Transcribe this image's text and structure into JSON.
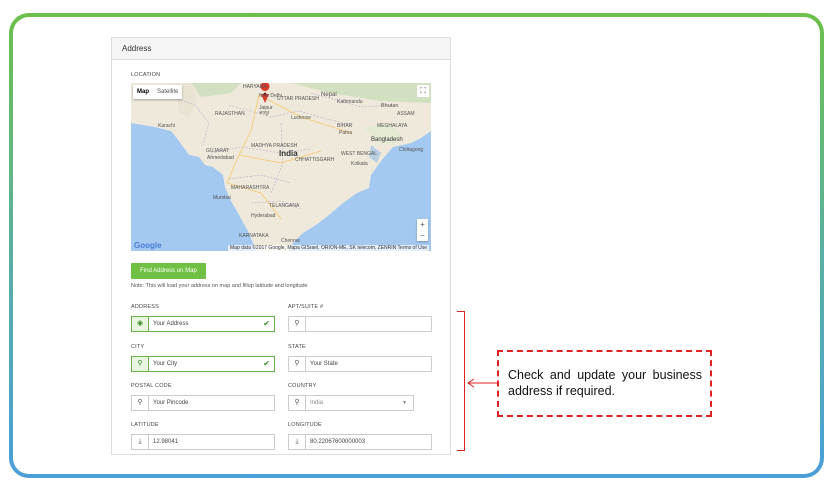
{
  "panel": {
    "title": "Address"
  },
  "location_label": "LOCATION",
  "map": {
    "type_map": "Map",
    "type_satellite": "Satellite",
    "fullscreen_glyph": "⛶",
    "zoom_in": "+",
    "zoom_out": "−",
    "logo": "Google",
    "footer": "Map data ©2017 Google, Mapa GISrael, ORION-ME, SK telecom, ZENRIN   Terms of Use",
    "places": {
      "haryana": "HARYANA",
      "delhi": "New Delhi",
      "jaipur": "Jaipur",
      "jaipur_native": "जयपुर",
      "uttar_pradesh": "UTTAR PRADESH",
      "lucknow": "Lucknow",
      "nepal": "Nepal",
      "kathmandu": "Kathmandu",
      "bhutan": "Bhutan",
      "assam": "ASSAM",
      "meghalaya": "MEGHALAYA",
      "rajasthan": "RAJASTHAN",
      "karachi": "Karachi",
      "bihar": "BIHAR",
      "patna": "Patna",
      "bangladesh": "Bangladesh",
      "gujarat": "GUJARAT",
      "ahmedabad": "Ahmedabad",
      "madhya_pradesh": "MADHYA PRADESH",
      "india": "India",
      "chhattisgarh": "CHHATTISGARH",
      "west_bengal": "WEST BENGAL",
      "kolkata": "Kolkata",
      "chittagong": "Chittagong",
      "maharashtra": "MAHARASHTRA",
      "mumbai": "Mumbai",
      "telangana": "TELANGANA",
      "hyderabad": "Hyderabad",
      "karnataka": "KARNATAKA",
      "chennai": "Chennai"
    }
  },
  "find_button": "Find Address on Map",
  "note": "Note: This will load your address on map and fillup latitude and longitude",
  "fields": {
    "address": {
      "label": "ADDRESS",
      "value": "Your Address"
    },
    "apt": {
      "label": "APT/SUITE #",
      "value": ""
    },
    "city": {
      "label": "CITY",
      "value": "Your City"
    },
    "state": {
      "label": "STATE",
      "value": "Your State"
    },
    "postal": {
      "label": "POSTAL CODE",
      "value": "Your Pincode"
    },
    "country": {
      "label": "COUNTRY",
      "value": "India"
    },
    "latitude": {
      "label": "LATITUDE",
      "value": "12.98041"
    },
    "longitude": {
      "label": "LONGITUDE",
      "value": "80.22067600000003"
    }
  },
  "callout": "Check and update your business address if required.",
  "colors": {
    "accent_green": "#70c043",
    "annotation_red": "#dd2222",
    "water": "#a4c9f0",
    "land": "#efe9dc"
  },
  "icons": {
    "globe": "globe-icon",
    "pin": "map-pin-icon",
    "check": "check-icon",
    "coordinate": "coordinate-icon",
    "caret": "caret-down-icon"
  }
}
